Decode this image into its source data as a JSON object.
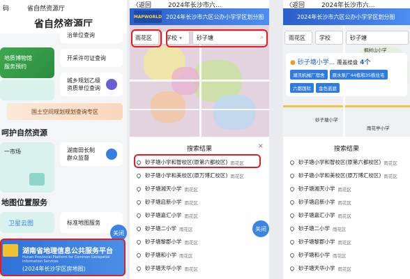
{
  "panel1": {
    "topbar": {
      "left": "码",
      "title": "省自然资源厅"
    },
    "header_title": "省自然资源厅",
    "card_mine": "治单位查询",
    "card_museum": [
      "地质博物馆",
      "服务预约"
    ],
    "card_permit": "开采许可证查询",
    "card_planning": [
      "城乡规划乙级",
      "资质单位查询"
    ],
    "bar_text": "国土空间规划规划查询专区",
    "section_protect": "呵护自然资源",
    "card_market": "一市场",
    "card_supervise": [
      "湖南田长制",
      "群众监督"
    ],
    "section_map": "地图位置服务",
    "card_satellite": "卫星云图",
    "card_standard_map": "标准地图服务",
    "banner": {
      "title": "湖南省地理信息公共服务平台",
      "sub": "Hunan Provincial Platform for Common Geospatial Information Services",
      "caption": "(2024年长沙学区房地图)"
    },
    "close": "关闭"
  },
  "panel2": {
    "nav_back": "〈返回",
    "nav_title": "2024年长沙市六...",
    "header": "2024年长沙市六区公办小学学区划分图",
    "logo": "MAPWORLD",
    "district": "雨花区",
    "type": "学校",
    "query": "砂子塘",
    "list_title": "搜索结果",
    "close": "关闭",
    "results": [
      {
        "name": "砂子塘小学和智校区(原第六都校区)",
        "dist": "雨花区"
      },
      {
        "name": "砂子塘小学和美校区(原万博汇校区)",
        "dist": "雨花区"
      },
      {
        "name": "砂子塘湘天小学",
        "dist": "雨花区"
      },
      {
        "name": "砂子塘启新小学",
        "dist": "雨花区"
      },
      {
        "name": "砂子塘嘉汇小学",
        "dist": "雨花区"
      },
      {
        "name": "砂子塘二小学",
        "dist": "雨花区"
      },
      {
        "name": "砂子塘黎郡小学",
        "dist": "雨花区"
      },
      {
        "name": "砂子塘和小学",
        "dist": "雨花区"
      },
      {
        "name": "砂子塘天华小学",
        "dist": "雨花区"
      }
    ]
  },
  "panel3": {
    "nav_back": "〈返回",
    "nav_title": "2024年长沙市六...",
    "header": "2024年长沙市六区公办小学学区划分图",
    "district": "雨花区",
    "type": "学校",
    "query": "砂子塘",
    "result_title": "砂子塘小学...",
    "result_cover": "覆盖楼盘",
    "result_count": "4个",
    "tags": [
      "湖汛机械厂宿舍",
      "原水泵厂44栋和35栋住宅",
      "六都国际",
      "金色蓝庭"
    ],
    "map_labels": [
      "枫树山小学",
      "砂子塘小学",
      "雨花亭小学"
    ],
    "list_title": "搜索结果",
    "results": [
      {
        "name": "砂子塘小学和智校区(原第六都校区)",
        "dist": "雨花区"
      },
      {
        "name": "砂子塘小学和美校区(原万博汇校区)",
        "dist": "雨花区"
      },
      {
        "name": "砂子塘湘天小学",
        "dist": "雨花区"
      },
      {
        "name": "砂子塘启新小学",
        "dist": "雨花区"
      },
      {
        "name": "砂子塘嘉汇小学",
        "dist": "雨花区"
      },
      {
        "name": "砂子塘二小学",
        "dist": "雨花区"
      },
      {
        "name": "砂子塘黎郡小学",
        "dist": "雨花区"
      },
      {
        "name": "砂子塘和小学",
        "dist": "雨花区"
      },
      {
        "name": "砂子塘天华小学",
        "dist": "雨花区"
      }
    ]
  },
  "colors": {
    "accent": "#3a84e3",
    "highlight": "#e02020",
    "brand_green": "#2b8d3f"
  }
}
